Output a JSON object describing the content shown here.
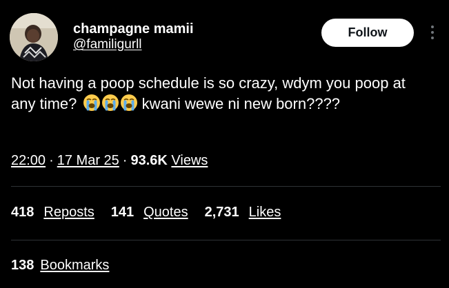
{
  "author": {
    "display_name": "champagne mamii",
    "handle": "@familigurll",
    "avatar_icon": "avatar-photo"
  },
  "actions": {
    "follow_label": "Follow",
    "more_icon": "more-dots-icon"
  },
  "tweet": {
    "text_before_emoji": "Not having a poop schedule is so crazy, wdym you poop at any time?",
    "emoji_names": [
      "loudly-crying-face-icon",
      "loudly-crying-face-icon",
      "loudly-crying-face-icon"
    ],
    "text_after_emoji": "kwani wewe ni new born????"
  },
  "meta": {
    "time": "22:00",
    "date": "17 Mar 25",
    "views_count": "93.6K",
    "views_label": "Views",
    "separator": "·"
  },
  "stats": {
    "reposts_count": "418",
    "reposts_label": "Reposts",
    "quotes_count": "141",
    "quotes_label": "Quotes",
    "likes_count": "2,731",
    "likes_label": "Likes",
    "bookmarks_count": "138",
    "bookmarks_label": "Bookmarks"
  },
  "colors": {
    "background": "#000000",
    "text": "#ffffff",
    "divider": "#2f3336",
    "follow_bg": "#ffffff",
    "follow_text": "#0f1419",
    "muted": "#71767b"
  }
}
